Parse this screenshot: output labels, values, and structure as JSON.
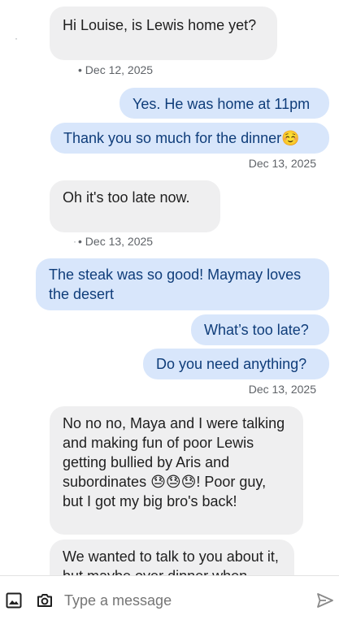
{
  "messages": [
    {
      "text": "Hi Louise, is Lewis home yet?"
    },
    {
      "text": "Yes. He was home at 11pm"
    },
    {
      "text": "Thank you so much for the dinner☺️"
    },
    {
      "text": "Oh it's too late now."
    },
    {
      "text": "The steak was so good! Maymay loves the desert"
    },
    {
      "text": "What’s too late?"
    },
    {
      "text": "Do you need anything?"
    },
    {
      "text": "No no no, Maya and I were talking and making fun of poor Lewis getting bullied by Aris and subordinates 😓😓😓!  Poor guy, but I got my big bro's back!"
    },
    {
      "text": "We wanted to talk to you about it, but maybe over dinner when"
    }
  ],
  "timestamps": {
    "t1": "• Dec 12, 2025",
    "t2": "Dec 13, 2025",
    "t3": "• Dec 13, 2025",
    "t4": "Dec 13, 2025"
  },
  "composer": {
    "placeholder": "Type a message"
  },
  "colors": {
    "incoming_bubble": "#efeff0",
    "outgoing_bubble": "#d8e6fb",
    "outgoing_text": "#0f3d7a"
  },
  "icons": [
    "image-icon",
    "camera-icon",
    "send-icon"
  ]
}
